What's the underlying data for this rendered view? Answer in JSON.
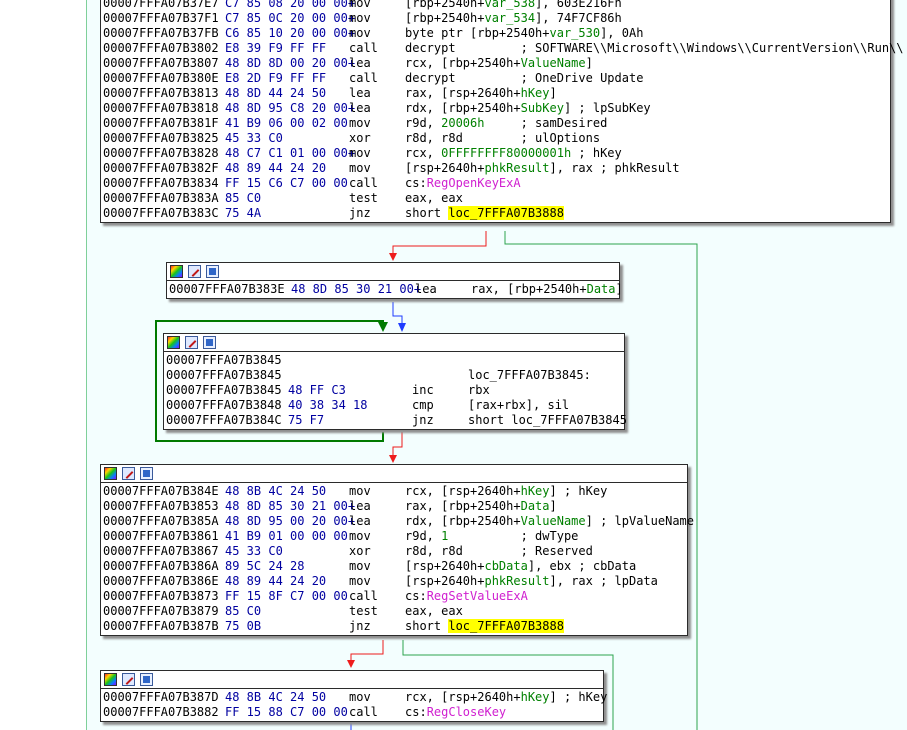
{
  "theme": {
    "background": "#ffffff",
    "graph_bg": "#f3fefe",
    "edge_true": "#2da44e",
    "edge_false": "#ee1c1c",
    "edge_uncond": "#1f3cff",
    "edge_loop": "#007a00",
    "highlight": "#ffff00",
    "address_color": "#000000",
    "bytes_color": "#0000a0",
    "variable_color": "#008000",
    "import_color": "#d020d0"
  },
  "header_icons": [
    "color-palette-icon",
    "edit-node-icon",
    "collapse-node-icon"
  ],
  "blocks": [
    {
      "id": "block-regopen",
      "has_header": false,
      "lines": [
        {
          "addr": "00007FFFA07B37E7",
          "bytes": "C7 85 08 20 00 00+",
          "mnem": "mov",
          "operands": [
            {
              "t": "[rbp+2540h+"
            },
            {
              "t": "var_538",
              "c": "var"
            },
            {
              "t": "], 603E216Fh"
            }
          ]
        },
        {
          "addr": "00007FFFA07B37F1",
          "bytes": "C7 85 0C 20 00 00+",
          "mnem": "mov",
          "operands": [
            {
              "t": "[rbp+2540h+"
            },
            {
              "t": "var_534",
              "c": "var"
            },
            {
              "t": "], 74F7CF86h"
            }
          ]
        },
        {
          "addr": "00007FFFA07B37FB",
          "bytes": "C6 85 10 20 00 00+",
          "mnem": "mov",
          "operands": [
            {
              "t": "byte ptr [rbp+2540h+"
            },
            {
              "t": "var_530",
              "c": "var"
            },
            {
              "t": "], 0Ah"
            }
          ]
        },
        {
          "addr": "00007FFFA07B3802",
          "bytes": "E8 39 F9 FF FF",
          "mnem": "call",
          "operands": [
            {
              "t": "decrypt         ; SOFTWARE\\\\Microsoft\\\\Windows\\\\CurrentVersion\\\\Run\\\\"
            }
          ]
        },
        {
          "addr": "00007FFFA07B3807",
          "bytes": "48 8D 8D 00 20 00+",
          "mnem": "lea",
          "operands": [
            {
              "t": "rcx, [rbp+2540h+"
            },
            {
              "t": "ValueName",
              "c": "var"
            },
            {
              "t": "]"
            }
          ]
        },
        {
          "addr": "00007FFFA07B380E",
          "bytes": "E8 2D F9 FF FF",
          "mnem": "call",
          "operands": [
            {
              "t": "decrypt         ; OneDrive Update"
            }
          ]
        },
        {
          "addr": "00007FFFA07B3813",
          "bytes": "48 8D 44 24 50",
          "mnem": "lea",
          "operands": [
            {
              "t": "rax, [rsp+2640h+"
            },
            {
              "t": "hKey",
              "c": "var"
            },
            {
              "t": "]"
            }
          ]
        },
        {
          "addr": "00007FFFA07B3818",
          "bytes": "48 8D 95 C8 20 00+",
          "mnem": "lea",
          "operands": [
            {
              "t": "rdx, [rbp+2540h+"
            },
            {
              "t": "SubKey",
              "c": "var"
            },
            {
              "t": "] ; lpSubKey"
            }
          ]
        },
        {
          "addr": "00007FFFA07B381F",
          "bytes": "41 B9 06 00 02 00",
          "mnem": "mov",
          "operands": [
            {
              "t": "r9d, "
            },
            {
              "t": "20006h",
              "c": "num"
            },
            {
              "t": "     ; samDesired"
            }
          ]
        },
        {
          "addr": "00007FFFA07B3825",
          "bytes": "45 33 C0",
          "mnem": "xor",
          "operands": [
            {
              "t": "r8d, r8d        ; ulOptions"
            }
          ]
        },
        {
          "addr": "00007FFFA07B3828",
          "bytes": "48 C7 C1 01 00 00+",
          "mnem": "mov",
          "operands": [
            {
              "t": "rcx, "
            },
            {
              "t": "0FFFFFFFF80000001h",
              "c": "num"
            },
            {
              "t": " ; hKey"
            }
          ]
        },
        {
          "addr": "00007FFFA07B382F",
          "bytes": "48 89 44 24 20",
          "mnem": "mov",
          "operands": [
            {
              "t": "[rsp+2640h+"
            },
            {
              "t": "phkResult",
              "c": "var"
            },
            {
              "t": "], rax ; phkResult"
            }
          ]
        },
        {
          "addr": "00007FFFA07B3834",
          "bytes": "FF 15 C6 C7 00 00",
          "mnem": "call",
          "operands": [
            {
              "t": "cs:"
            },
            {
              "t": "RegOpenKeyExA",
              "c": "imp"
            }
          ]
        },
        {
          "addr": "00007FFFA07B383A",
          "bytes": "85 C0",
          "mnem": "test",
          "operands": [
            {
              "t": "eax, eax"
            }
          ]
        },
        {
          "addr": "00007FFFA07B383C",
          "bytes": "75 4A",
          "mnem": "jnz",
          "operands": [
            {
              "t": "short "
            },
            {
              "t": "loc_7FFFA07B3888",
              "c": "hl"
            }
          ]
        }
      ]
    },
    {
      "id": "block-lea-data",
      "has_header": true,
      "lines": [
        {
          "addr": "00007FFFA07B383E",
          "bytes": "48 8D 85 30 21 00+",
          "mnem": "lea",
          "operands": [
            {
              "t": "rax, [rbp+2540h+"
            },
            {
              "t": "Data",
              "c": "var"
            },
            {
              "t": "]"
            }
          ]
        }
      ]
    },
    {
      "id": "block-loop",
      "has_header": true,
      "lines": [
        {
          "addr": "00007FFFA07B3845",
          "bytes": "",
          "mnem": "",
          "operands": []
        },
        {
          "addr": "00007FFFA07B3845",
          "bytes": "",
          "mnem": "",
          "label": "loc_7FFFA07B3845:",
          "operands": []
        },
        {
          "addr": "00007FFFA07B3845",
          "bytes": "48 FF C3",
          "mnem": "inc",
          "operands": [
            {
              "t": "rbx"
            }
          ]
        },
        {
          "addr": "00007FFFA07B3848",
          "bytes": "40 38 34 18",
          "mnem": "cmp",
          "operands": [
            {
              "t": "[rax+rbx], sil"
            }
          ]
        },
        {
          "addr": "00007FFFA07B384C",
          "bytes": "75 F7",
          "mnem": "jnz",
          "operands": [
            {
              "t": "short loc_7FFFA07B3845"
            }
          ]
        }
      ]
    },
    {
      "id": "block-regset",
      "has_header": true,
      "lines": [
        {
          "addr": "00007FFFA07B384E",
          "bytes": "48 8B 4C 24 50",
          "mnem": "mov",
          "operands": [
            {
              "t": "rcx, [rsp+2640h+"
            },
            {
              "t": "hKey",
              "c": "var"
            },
            {
              "t": "] ; hKey"
            }
          ]
        },
        {
          "addr": "00007FFFA07B3853",
          "bytes": "48 8D 85 30 21 00+",
          "mnem": "lea",
          "operands": [
            {
              "t": "rax, [rbp+2540h+"
            },
            {
              "t": "Data",
              "c": "var"
            },
            {
              "t": "]"
            }
          ]
        },
        {
          "addr": "00007FFFA07B385A",
          "bytes": "48 8D 95 00 20 00+",
          "mnem": "lea",
          "operands": [
            {
              "t": "rdx, [rbp+2540h+"
            },
            {
              "t": "ValueName",
              "c": "var"
            },
            {
              "t": "] ; lpValueName"
            }
          ]
        },
        {
          "addr": "00007FFFA07B3861",
          "bytes": "41 B9 01 00 00 00",
          "mnem": "mov",
          "operands": [
            {
              "t": "r9d, "
            },
            {
              "t": "1",
              "c": "num"
            },
            {
              "t": "          ; dwType"
            }
          ]
        },
        {
          "addr": "00007FFFA07B3867",
          "bytes": "45 33 C0",
          "mnem": "xor",
          "operands": [
            {
              "t": "r8d, r8d        ; Reserved"
            }
          ]
        },
        {
          "addr": "00007FFFA07B386A",
          "bytes": "89 5C 24 28",
          "mnem": "mov",
          "operands": [
            {
              "t": "[rsp+2640h+"
            },
            {
              "t": "cbData",
              "c": "var"
            },
            {
              "t": "], ebx ; cbData"
            }
          ]
        },
        {
          "addr": "00007FFFA07B386E",
          "bytes": "48 89 44 24 20",
          "mnem": "mov",
          "operands": [
            {
              "t": "[rsp+2640h+"
            },
            {
              "t": "phkResult",
              "c": "var"
            },
            {
              "t": "], rax ; lpData"
            }
          ]
        },
        {
          "addr": "00007FFFA07B3873",
          "bytes": "FF 15 8F C7 00 00",
          "mnem": "call",
          "operands": [
            {
              "t": "cs:"
            },
            {
              "t": "RegSetValueExA",
              "c": "imp"
            }
          ]
        },
        {
          "addr": "00007FFFA07B3879",
          "bytes": "85 C0",
          "mnem": "test",
          "operands": [
            {
              "t": "eax, eax"
            }
          ]
        },
        {
          "addr": "00007FFFA07B387B",
          "bytes": "75 0B",
          "mnem": "jnz",
          "operands": [
            {
              "t": "short "
            },
            {
              "t": "loc_7FFFA07B3888",
              "c": "hl"
            }
          ]
        }
      ]
    },
    {
      "id": "block-regclose",
      "has_header": true,
      "lines": [
        {
          "addr": "00007FFFA07B387D",
          "bytes": "48 8B 4C 24 50",
          "mnem": "mov",
          "operands": [
            {
              "t": "rcx, [rsp+2640h+"
            },
            {
              "t": "hKey",
              "c": "var"
            },
            {
              "t": "] ; hKey"
            }
          ]
        },
        {
          "addr": "00007FFFA07B3882",
          "bytes": "FF 15 88 C7 00 00",
          "mnem": "call",
          "operands": [
            {
              "t": "cs:"
            },
            {
              "t": "RegCloseKey",
              "c": "imp"
            }
          ]
        }
      ]
    }
  ]
}
